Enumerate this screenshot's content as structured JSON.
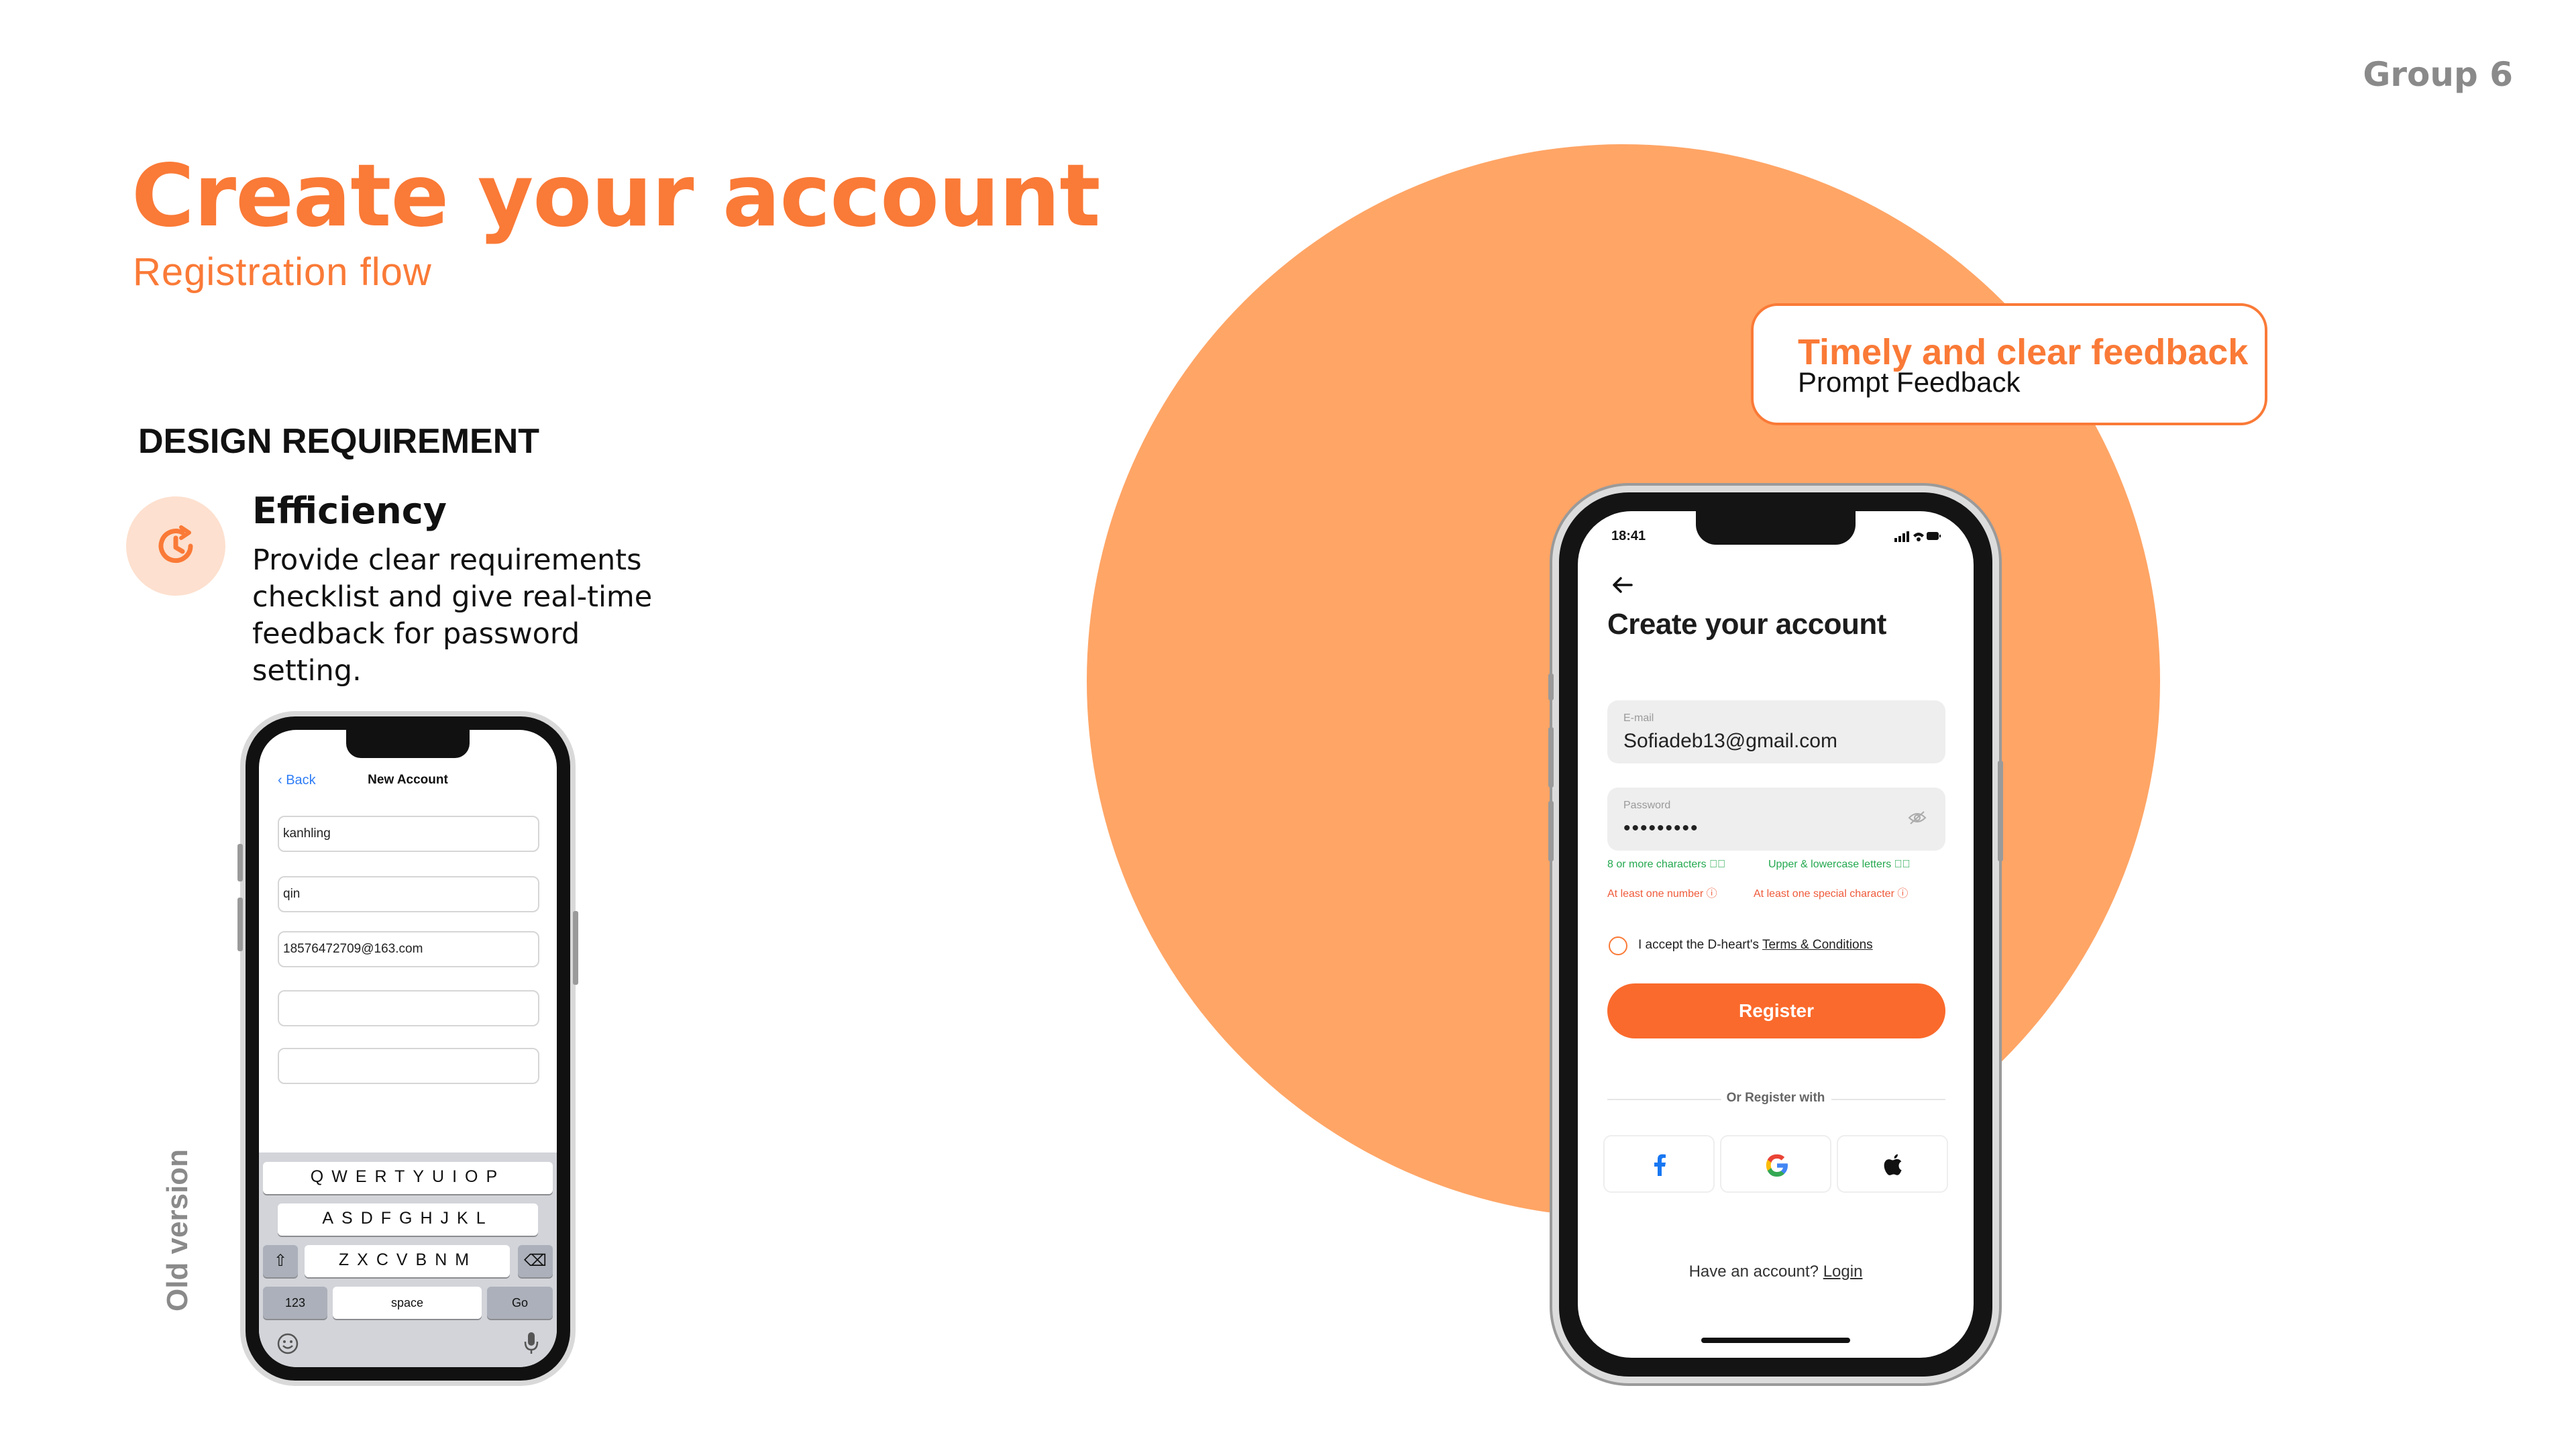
{
  "slide": {
    "group_label": "Group 6",
    "title": "Create your account",
    "subtitle": "Registration flow",
    "requirement_heading": "DESIGN REQUIREMENT",
    "requirement": {
      "icon": "clock-refresh-icon",
      "title": "Efficiency",
      "description": "Provide clear requirements checklist and give real-time feedback for password setting."
    },
    "old_version_label": "Old version",
    "accent_color": "#fa7a37",
    "circle_color": "#ffa566"
  },
  "callout": {
    "title": "Timely and clear feedback",
    "subtitle": "Prompt Feedback"
  },
  "old_phone": {
    "back_label": "Back",
    "nav_title": "New Account",
    "fields": [
      "kanhling",
      "qin",
      "18576472709@163.com",
      "",
      ""
    ],
    "keyboard": {
      "row1": "QWERTYUIOP",
      "row2": "ASDFGHJKL",
      "row3": "ZXCVBNM",
      "numbers_key": "123",
      "space_key": "space",
      "go_key": "Go"
    }
  },
  "new_phone": {
    "status_time": "18:41",
    "screen_title": "Create your account",
    "email": {
      "label": "E-mail",
      "value": "Sofiadeb13@gmail.com"
    },
    "password": {
      "label": "Password",
      "value": "•••••••••"
    },
    "checks": [
      {
        "text": "8 or more characters",
        "state": "ok"
      },
      {
        "text": "Upper & lowercase letters",
        "state": "ok"
      },
      {
        "text": "At least one number",
        "state": "error"
      },
      {
        "text": "At least one special character",
        "state": "error"
      }
    ],
    "terms_prefix": "I accept the D-heart's ",
    "terms_link": "Terms & Conditions",
    "register_label": "Register",
    "or_register_with": "Or Register with",
    "social": [
      "facebook-icon",
      "google-icon",
      "apple-icon"
    ],
    "have_account": "Have an account? ",
    "login_link": "Login",
    "ok_color": "#23a84f",
    "error_color": "#ef5a3a",
    "button_color": "#fa6a2c"
  }
}
